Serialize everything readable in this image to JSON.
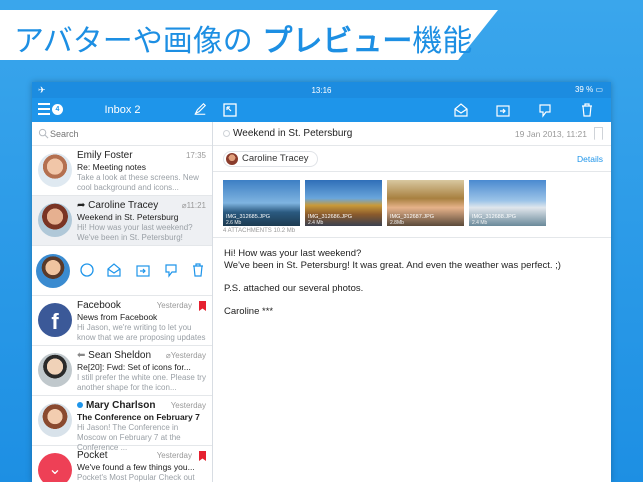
{
  "banner": {
    "title_normal": "アバターや画像の ",
    "title_bold": "プレビュー",
    "title_tail": "機能"
  },
  "statusbar": {
    "time": "13:16",
    "battery": "39 %"
  },
  "toolbar": {
    "inbox_title": "Inbox 2",
    "unread_count": "4"
  },
  "search": {
    "placeholder": "Search"
  },
  "messages": [
    {
      "sender": "Emily Foster",
      "time": "17:35",
      "subject": "Re: Meeting notes",
      "preview": "Take a look at these screens. New cool background and icons..."
    },
    {
      "sender": "Caroline Tracey",
      "time": "11:21",
      "subject": "Weekend in St. Petersburg",
      "preview": "Hi! How was your last weekend? We've been in St. Petersburg!"
    },
    {
      "sender": "Facebook",
      "time": "Yesterday",
      "subject": "News from Facebook",
      "preview": "Hi Jason, we're writing to let you know that we are proposing updates"
    },
    {
      "sender": "Sean Sheldon",
      "time": "Yesterday",
      "subject": "Re[20]: Fwd: Set of icons for...",
      "preview": "I still prefer the white one. Please try another shape for the icon..."
    },
    {
      "sender": "Mary Charlson",
      "time": "Yesterday",
      "subject": "The Conference on February 7",
      "preview": "Hi Jason! The Conference in Moscow on February 7 at the Conference ..."
    },
    {
      "sender": "Pocket",
      "time": "Yesterday",
      "subject": "We've found a few things you...",
      "preview": "Pocket's Most Popular Check out"
    }
  ],
  "reader": {
    "subject": "Weekend in St. Petersburg",
    "date": "19 Jan 2013, 11:21",
    "from": "Caroline Tracey",
    "details": "Details",
    "attachments_count": "4 ATTACHMENTS 10.2 Mb",
    "attachments": [
      {
        "name": "IMG_312685.JPG",
        "size": "2.6 Mb"
      },
      {
        "name": "IMG_312686.JPG",
        "size": "2.4 Mb"
      },
      {
        "name": "IMG_312687.JPG",
        "size": "2.8Mb"
      },
      {
        "name": "IMG_312688.JPG",
        "size": "2.4 Mb"
      }
    ],
    "body": [
      "Hi! How was your last weekend?",
      "We've been in St. Petersburg! It was great. And even the weather was perfect. ;)",
      "P.S. attached our several photos.",
      "Caroline ***"
    ]
  },
  "colors": {
    "accent": "#1e95ea",
    "flag": "#e5202f",
    "background": "#2f9ceb"
  }
}
